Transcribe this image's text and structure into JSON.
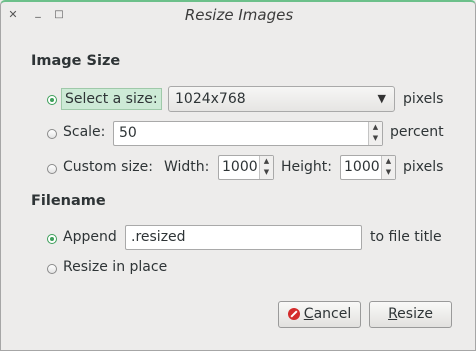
{
  "window": {
    "title": "Resize Images",
    "close_glyph": "✕",
    "minimize_glyph": "_",
    "maximize_glyph": "□"
  },
  "image_size": {
    "heading": "Image Size",
    "select_size": {
      "label": "Select a size:",
      "value": "1024x768",
      "unit": "pixels",
      "checked": true
    },
    "scale": {
      "label": "Scale:",
      "value": "50",
      "unit": "percent",
      "checked": false
    },
    "custom_size": {
      "label": "Custom size:",
      "width_label": "Width:",
      "width_value": "1000",
      "height_label": "Height:",
      "height_value": "1000",
      "unit": "pixels",
      "checked": false
    }
  },
  "filename": {
    "heading": "Filename",
    "append": {
      "label": "Append",
      "value": ".resized",
      "suffix": "to file title",
      "checked": true
    },
    "in_place": {
      "label": "Resize in place",
      "checked": false
    }
  },
  "buttons": {
    "cancel_mnemonic": "C",
    "cancel_rest": "ancel",
    "resize_mnemonic": "R",
    "resize_rest": "esize"
  },
  "colors": {
    "accent": "#3d9f5a",
    "focus": "#cdead6",
    "cancel_icon": "#d42c2c"
  }
}
